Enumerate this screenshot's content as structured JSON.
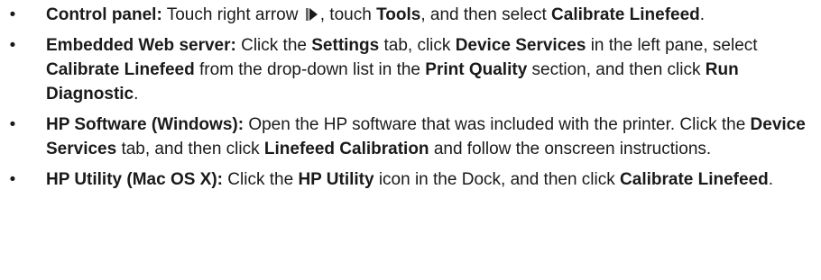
{
  "bullet_char": "•",
  "steps": [
    {
      "head": "Control panel:",
      "t1": " Touch right arrow ",
      "icon": "right-arrow-icon",
      "t2": ", touch ",
      "b1": "Tools",
      "t3": ", and then select ",
      "b2": "Calibrate Linefeed",
      "t4": "."
    },
    {
      "head": "Embedded Web server:",
      "t1": " Click the ",
      "b1": "Settings",
      "t2": " tab, click ",
      "b2": "Device Services",
      "t3": " in the left pane, select ",
      "b3": "Calibrate Linefeed",
      "t4": " from the drop-down list in the ",
      "b4": "Print Quality",
      "t5": " section, and then click ",
      "b5": "Run Diagnostic",
      "t6": "."
    },
    {
      "head": "HP Software (Windows):",
      "t1": " Open the HP software that was included with the printer. Click the ",
      "b1": "Device Services",
      "t2": " tab, and then click ",
      "b2": "Linefeed Calibration",
      "t3": " and follow the onscreen instructions."
    },
    {
      "head": "HP Utility (Mac OS X):",
      "t1": " Click the ",
      "b1": "HP Utility",
      "t2": " icon in the Dock, and then click ",
      "b2": "Calibrate Linefeed",
      "t3": "."
    }
  ]
}
